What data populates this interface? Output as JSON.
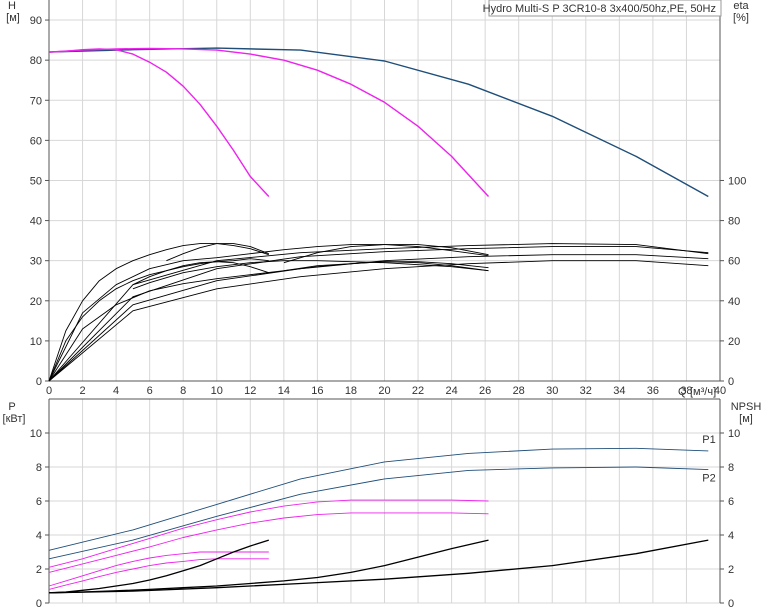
{
  "chart_data": [
    {
      "type": "line",
      "title": "Hydro Multi-S P 3CR10-8 3x400/50hz,PE, 50Hz",
      "xlabel": "Q [м³/ч]",
      "xlabel_short": "Q",
      "xunit": "[м³/ч]",
      "xlim": [
        0,
        40
      ],
      "x_ticks": [
        0,
        2,
        4,
        6,
        8,
        10,
        12,
        14,
        16,
        18,
        20,
        22,
        24,
        26,
        28,
        30,
        32,
        34,
        36,
        38,
        40
      ],
      "ylabel_left": "H",
      "yunit_left": "[м]",
      "ylim_left": [
        0,
        95
      ],
      "y_ticks_left": [
        0,
        10,
        20,
        30,
        40,
        50,
        60,
        70,
        80,
        90
      ],
      "ylabel_right": "eta",
      "yunit_right": "[%]",
      "ylim_right": [
        0,
        190
      ],
      "y_ticks_right": [
        0,
        20,
        40,
        60,
        80,
        100
      ],
      "grid": true,
      "colors": {
        "head_max": "#1f4e79",
        "head_reduced": "#ee22ee",
        "eta": "#000000"
      },
      "series": [
        {
          "role": "head",
          "color": "#1f4e79",
          "x": [
            0,
            5,
            10,
            15,
            20,
            25,
            30,
            35,
            39.3
          ],
          "y": [
            82,
            82.6,
            83,
            82.5,
            79.8,
            74,
            66,
            56,
            46
          ]
        },
        {
          "role": "head",
          "color": "#ee22ee",
          "x": [
            0,
            2,
            4,
            6,
            8,
            10,
            12,
            14,
            16,
            18,
            20,
            22,
            24,
            26.2
          ],
          "y": [
            82,
            82.5,
            82.8,
            82.9,
            82.8,
            82.5,
            81.5,
            80,
            77.5,
            74,
            69.5,
            63.5,
            56,
            46
          ]
        },
        {
          "role": "head",
          "color": "#ee22ee",
          "x": [
            0,
            1,
            2,
            3,
            4,
            5,
            6,
            7,
            8,
            9,
            10,
            11,
            12,
            13.1
          ],
          "y": [
            82,
            82.2,
            82.6,
            82.8,
            82.6,
            81.5,
            79.5,
            77,
            73.5,
            69,
            63.5,
            57.5,
            51,
            46
          ]
        },
        {
          "role": "eta",
          "x": [
            0,
            5,
            10,
            15,
            20,
            25,
            30,
            35,
            39.3
          ],
          "y": [
            0,
            35,
            46,
            52,
            56,
            58.5,
            60,
            60,
            57.5
          ]
        },
        {
          "role": "eta",
          "x": [
            0,
            5,
            10,
            15,
            20,
            25,
            30,
            35,
            39.3
          ],
          "y": [
            0,
            38,
            50,
            56,
            60,
            62,
            63,
            63,
            61
          ]
        },
        {
          "role": "eta",
          "x": [
            0,
            5,
            10,
            15,
            20,
            25,
            30,
            35,
            39.3
          ],
          "y": [
            0,
            42,
            56,
            62,
            64.5,
            66,
            67,
            67,
            64
          ]
        },
        {
          "role": "eta",
          "x": [
            0,
            5,
            10,
            15,
            20,
            25,
            30,
            35,
            39.3
          ],
          "y": [
            0,
            48,
            60,
            64,
            66,
            67.5,
            68.5,
            68,
            63.5
          ]
        },
        {
          "role": "eta",
          "x": [
            0,
            2,
            4,
            6,
            8,
            10,
            12,
            14,
            16,
            18,
            20,
            22,
            24,
            26.2
          ],
          "y": [
            0,
            26,
            38,
            45,
            48.5,
            51,
            53,
            55,
            57,
            58.5,
            59.5,
            59,
            57.5,
            55
          ]
        },
        {
          "role": "eta",
          "x": [
            0,
            2,
            4,
            6,
            8,
            10,
            12,
            14,
            16,
            18,
            20,
            22,
            24,
            26.2
          ],
          "y": [
            0,
            34,
            48,
            56,
            60,
            61.5,
            63.5,
            65.5,
            67,
            68,
            68,
            67,
            65,
            62.5
          ]
        },
        {
          "role": "eta",
          "x": [
            5,
            6,
            8,
            10,
            12,
            14,
            16,
            18,
            20,
            22,
            24,
            26.2
          ],
          "y": [
            46,
            49,
            54,
            57,
            59,
            60,
            60,
            59.5,
            59,
            58,
            57,
            55
          ]
        },
        {
          "role": "eta",
          "x": [
            0,
            1,
            2,
            3,
            4,
            5,
            6,
            7,
            8,
            9,
            10,
            11,
            12,
            13.1
          ],
          "y": [
            0,
            20,
            32,
            40,
            46,
            50,
            53,
            55,
            57,
            58.5,
            59.5,
            60,
            61,
            60
          ]
        },
        {
          "role": "eta",
          "x": [
            0,
            1,
            2,
            3,
            4,
            5,
            6,
            7,
            8,
            9,
            10,
            11,
            12,
            13.1
          ],
          "y": [
            0,
            25,
            40,
            50,
            56,
            60,
            63,
            65.5,
            67.5,
            68.5,
            68.5,
            67.5,
            66,
            63
          ]
        },
        {
          "role": "eta",
          "x": [
            5,
            6,
            7,
            8,
            9,
            10,
            11,
            12,
            13.1
          ],
          "y": [
            48,
            52,
            55,
            57.5,
            59,
            59.5,
            59,
            57,
            54
          ]
        },
        {
          "role": "eta",
          "x": [
            7,
            8,
            9,
            10,
            11,
            12,
            13.1
          ],
          "y": [
            60,
            63.5,
            66.5,
            68.5,
            68.5,
            67,
            63.5
          ]
        },
        {
          "role": "eta",
          "x": [
            14,
            16,
            18,
            20,
            22,
            24,
            26.2
          ],
          "y": [
            59,
            64,
            67,
            68,
            68,
            66.5,
            63
          ]
        },
        {
          "role": "eta",
          "x": [
            14,
            16,
            18,
            20,
            22,
            24,
            26.2
          ],
          "y": [
            55,
            57.5,
            58.5,
            59.5,
            59.5,
            58.5,
            56.5
          ]
        }
      ]
    },
    {
      "type": "line",
      "xlim": [
        0,
        40
      ],
      "ylabel_left": "P",
      "yunit_left": "[кВт]",
      "ylim_left": [
        0,
        12
      ],
      "y_ticks_left": [
        0,
        2,
        4,
        6,
        8,
        10
      ],
      "ylabel_right": "NPSH",
      "yunit_right": "[м]",
      "ylim_right": [
        0,
        12
      ],
      "y_ticks_right": [
        0,
        2,
        4,
        6,
        8,
        10
      ],
      "grid": true,
      "series": [
        {
          "name": "P1",
          "role": "power",
          "color": "#1f4e79",
          "x": [
            0,
            5,
            10,
            15,
            20,
            25,
            30,
            35,
            39.3
          ],
          "y": [
            3.1,
            4.3,
            5.8,
            7.3,
            8.3,
            8.8,
            9.05,
            9.1,
            8.95
          ]
        },
        {
          "name": "P2",
          "role": "power",
          "color": "#1f4e79",
          "x": [
            0,
            5,
            10,
            15,
            20,
            25,
            30,
            35,
            39.3
          ],
          "y": [
            2.6,
            3.7,
            5.1,
            6.4,
            7.3,
            7.8,
            7.95,
            8.0,
            7.85
          ]
        },
        {
          "role": "power",
          "color": "#ee22ee",
          "x": [
            0,
            2,
            4,
            6,
            8,
            10,
            12,
            14,
            16,
            18,
            20,
            22,
            24,
            26.2
          ],
          "y": [
            2.1,
            2.6,
            3.2,
            3.8,
            4.4,
            4.9,
            5.35,
            5.7,
            5.95,
            6.05,
            6.05,
            6.05,
            6.05,
            6.0
          ]
        },
        {
          "role": "power",
          "color": "#ee22ee",
          "x": [
            0,
            2,
            4,
            6,
            8,
            10,
            12,
            14,
            16,
            18,
            20,
            22,
            24,
            26.2
          ],
          "y": [
            1.8,
            2.3,
            2.8,
            3.3,
            3.85,
            4.3,
            4.7,
            5.0,
            5.2,
            5.3,
            5.3,
            5.3,
            5.3,
            5.25
          ]
        },
        {
          "role": "power",
          "color": "#ee22ee",
          "x": [
            0,
            1,
            2,
            3,
            4,
            5,
            6,
            7,
            8,
            9,
            10,
            11,
            12,
            13.1
          ],
          "y": [
            1.0,
            1.3,
            1.6,
            1.9,
            2.2,
            2.45,
            2.65,
            2.8,
            2.9,
            3.0,
            3.0,
            3.0,
            3.0,
            3.0
          ]
        },
        {
          "role": "power",
          "color": "#ee22ee",
          "x": [
            0,
            1,
            2,
            3,
            4,
            5,
            6,
            7,
            8,
            9,
            10,
            11,
            12,
            13.1
          ],
          "y": [
            0.8,
            1.05,
            1.3,
            1.55,
            1.8,
            2.0,
            2.2,
            2.35,
            2.45,
            2.55,
            2.6,
            2.6,
            2.6,
            2.6
          ]
        },
        {
          "role": "npsh",
          "color": "#000000",
          "x": [
            0,
            5,
            10,
            15,
            20,
            25,
            30,
            35,
            39.3
          ],
          "y": [
            0.6,
            0.7,
            0.9,
            1.15,
            1.4,
            1.75,
            2.2,
            2.9,
            3.7
          ]
        },
        {
          "role": "npsh",
          "color": "#000000",
          "x": [
            0,
            2,
            4,
            6,
            8,
            10,
            12,
            14,
            16,
            18,
            20,
            22,
            24,
            26.2
          ],
          "y": [
            0.6,
            0.65,
            0.72,
            0.8,
            0.9,
            1.0,
            1.15,
            1.3,
            1.5,
            1.8,
            2.2,
            2.7,
            3.2,
            3.7
          ]
        },
        {
          "role": "npsh",
          "color": "#000000",
          "x": [
            0,
            1,
            2,
            3,
            4,
            5,
            6,
            7,
            8,
            9,
            10,
            11,
            12,
            13.1
          ],
          "y": [
            0.6,
            0.65,
            0.75,
            0.85,
            1.0,
            1.15,
            1.35,
            1.6,
            1.9,
            2.2,
            2.6,
            3.0,
            3.35,
            3.7
          ]
        }
      ]
    }
  ]
}
